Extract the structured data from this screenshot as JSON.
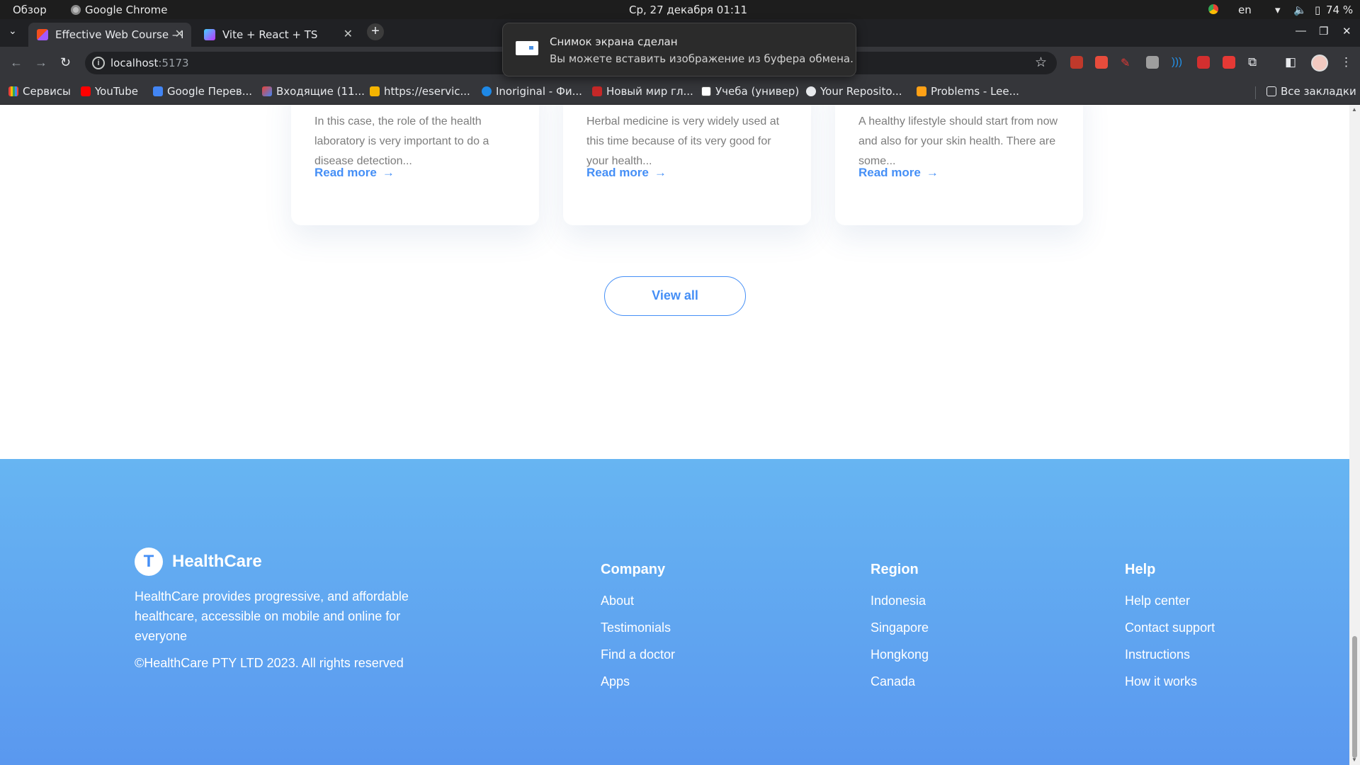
{
  "os": {
    "overview": "Обзор",
    "app": "Google Chrome",
    "datetime": "Ср, 27 декабря  01:11",
    "lang": "en",
    "battery": "74 %"
  },
  "tabs": [
    {
      "title": "Effective Web Course – F",
      "active": true
    },
    {
      "title": "Vite + React + TS",
      "active": false
    }
  ],
  "toolbar": {
    "url_host": "localhost",
    "url_port": ":5173"
  },
  "bookmarks": [
    {
      "label": "Сервисы",
      "icon": "apps-grid-icon"
    },
    {
      "label": "YouTube",
      "icon": "youtube-icon"
    },
    {
      "label": "Google Перев...",
      "icon": "google-translate-icon"
    },
    {
      "label": "Входящие (11...",
      "icon": "gmail-icon"
    },
    {
      "label": "https://eservic...",
      "icon": "site-icon"
    },
    {
      "label": "Inoriginal - Фи...",
      "icon": "inoriginal-icon"
    },
    {
      "label": "Новый мир гл...",
      "icon": "newworld-icon"
    },
    {
      "label": "Учеба (универ)",
      "icon": "notion-icon"
    },
    {
      "label": "Your Reposito...",
      "icon": "github-icon"
    },
    {
      "label": "Problems - Lee...",
      "icon": "leetcode-icon"
    }
  ],
  "all_bookmarks": "Все закладки",
  "notification": {
    "title": "Снимок экрана сделан",
    "body": "Вы можете вставить изображение из буфера обмена."
  },
  "articles": [
    {
      "excerpt": "In this case, the role of the health laboratory is very important to do a disease detection...",
      "link": "Read more"
    },
    {
      "excerpt": "Herbal medicine is very widely used at this time because of its very good for your health...",
      "link": "Read more"
    },
    {
      "excerpt": "A healthy lifestyle should start from now and also for your skin health. There are some...",
      "link": "Read more"
    }
  ],
  "view_all": "View all",
  "footer": {
    "logo_letter": "T",
    "brand": "HealthCare",
    "tagline": "HealthCare provides progressive, and affordable healthcare, accessible on mobile and online for everyone",
    "copyright": "©HealthCare PTY LTD 2023. All rights reserved",
    "columns": [
      {
        "title": "Company",
        "links": [
          "About",
          "Testimonials",
          "Find a doctor",
          "Apps"
        ]
      },
      {
        "title": "Region",
        "links": [
          "Indonesia",
          "Singapore",
          "Hongkong",
          "Canada"
        ]
      },
      {
        "title": "Help",
        "links": [
          "Help center",
          "Contact support",
          "Instructions",
          "How it works"
        ]
      }
    ]
  },
  "colors": {
    "accent": "#458ff6",
    "footer_top": "#67b5f2",
    "footer_bottom": "#5a98ef",
    "excerpt_text": "#7d7d7d"
  }
}
